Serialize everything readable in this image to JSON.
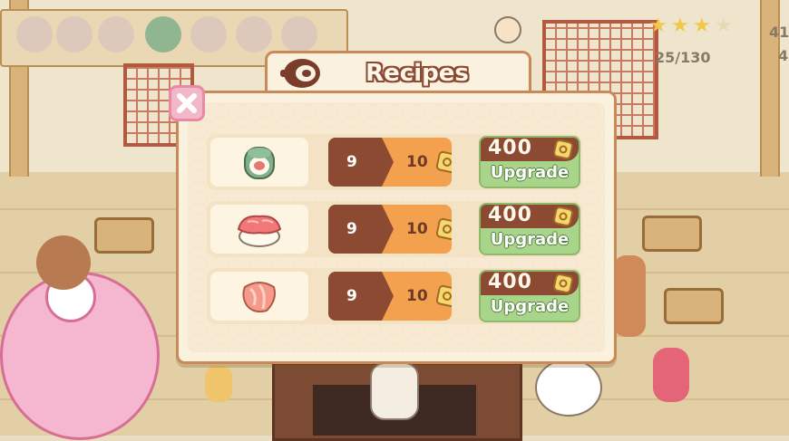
{
  "dialog": {
    "title": "Recipes",
    "title_icon": "recipe-book-icon",
    "close_icon": "close-icon"
  },
  "recipes": [
    {
      "dish_icon": "maki-roll-icon",
      "level_current": "9",
      "level_next": "10",
      "upgrade_cost": "400",
      "upgrade_label": "Upgrade"
    },
    {
      "dish_icon": "tuna-nigiri-icon",
      "level_current": "9",
      "level_next": "10",
      "upgrade_cost": "400",
      "upgrade_label": "Upgrade"
    },
    {
      "dish_icon": "salmon-slices-icon",
      "level_current": "9",
      "level_next": "10",
      "upgrade_cost": "400",
      "upgrade_label": "Upgrade"
    }
  ],
  "hud": {
    "stars": 4,
    "progress_text": "25/130",
    "top_right_1": "41",
    "top_right_2": "4"
  },
  "colors": {
    "panel_bg": "#fbf1df",
    "panel_border": "#c98a57",
    "level_dark": "#8d4a32",
    "level_orange": "#f3a14e",
    "upgrade_green": "#a8d58a",
    "close_pink": "#f3b8c8"
  }
}
